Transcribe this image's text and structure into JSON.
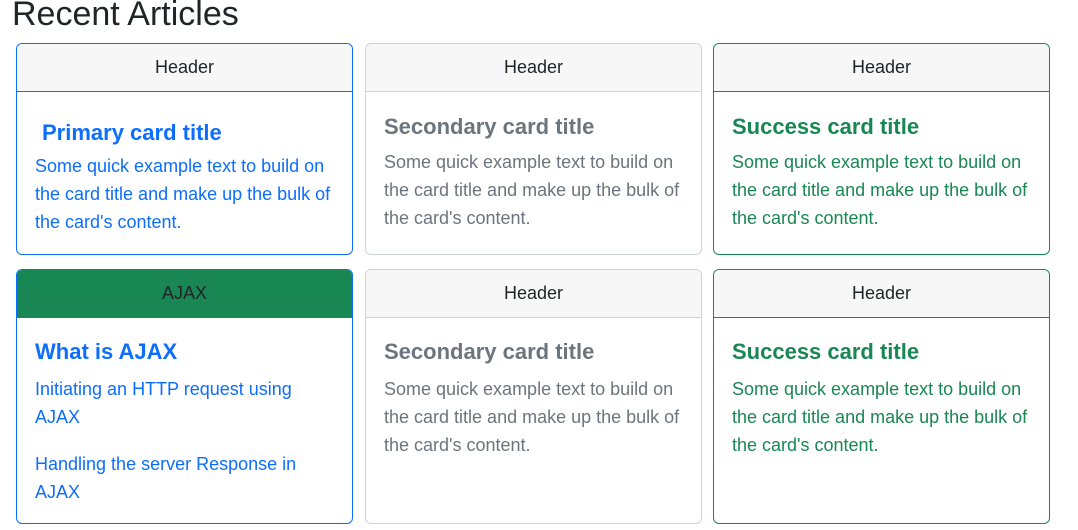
{
  "page": {
    "title": "Recent Articles"
  },
  "cards": [
    {
      "header": "Header",
      "title": "Primary card title",
      "text": "Some quick example text to build on the card title and make up the bulk of the card's content."
    },
    {
      "header": "Header",
      "title": "Secondary card title",
      "text": "Some quick example text to build on the card title and make up the bulk of the card's content."
    },
    {
      "header": "Header",
      "title": "Success card title",
      "text": "Some quick example text to build on the card title and make up the bulk of the card's content."
    },
    {
      "header": "AJAX",
      "title": "What is AJAX",
      "links": [
        "Initiating an HTTP request using AJAX",
        "Handling the server Response in AJAX"
      ]
    },
    {
      "header": "Header",
      "title": "Secondary card title",
      "text": "Some quick example text to build on the card title and make up the bulk of the card's content."
    },
    {
      "header": "Header",
      "title": "Success card title",
      "text": "Some quick example text to build on the card title and make up the bulk of the card's content."
    }
  ],
  "colors": {
    "primary": "#0d6efd",
    "secondary": "#6c757d",
    "success": "#198754",
    "header_bg": "#f7f7f7",
    "ajax_header_bg": "#198754"
  }
}
